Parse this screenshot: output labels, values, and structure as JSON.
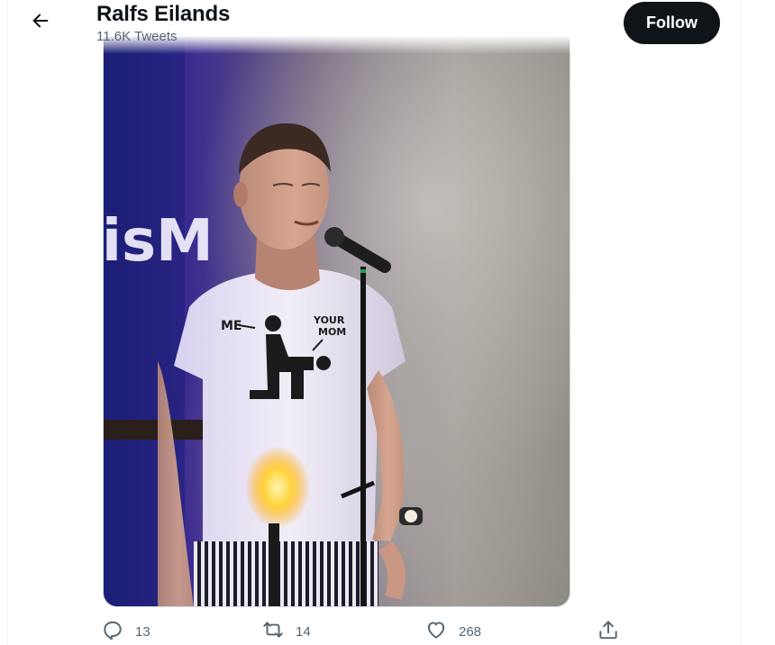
{
  "header": {
    "name": "Ralfs Eilands",
    "tweet_count": "11.6K Tweets",
    "follow_label": "Follow"
  },
  "media": {
    "shirt_text_left": "ME",
    "shirt_text_right_line1": "YOUR",
    "shirt_text_right_line2": "MOM",
    "sign_text": "isM"
  },
  "actions": {
    "reply_count": "13",
    "retweet_count": "14",
    "like_count": "268"
  },
  "icons": {
    "back": "arrow-left-icon",
    "reply": "speech-bubble-icon",
    "retweet": "retweet-arrows-icon",
    "like": "heart-icon",
    "share": "share-upload-icon"
  },
  "colors": {
    "follow_bg": "#0f1419",
    "muted_text": "#536471",
    "stage_purple": "#3b2a8f"
  }
}
